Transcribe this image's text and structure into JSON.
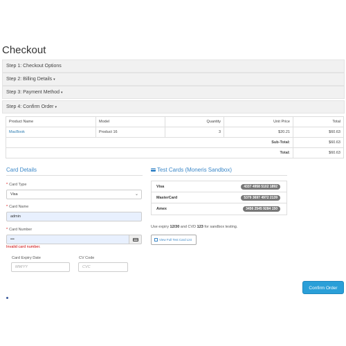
{
  "page": {
    "title": "Checkout"
  },
  "steps": [
    {
      "label": "Step 1: Checkout Options",
      "caret": ""
    },
    {
      "label": "Step 2: Billing Details",
      "caret": "▾"
    },
    {
      "label": "Step 3: Payment Method",
      "caret": "▾"
    },
    {
      "label": "Step 4: Confirm Order",
      "caret": "▾"
    }
  ],
  "cart": {
    "headers": {
      "product": "Product Name",
      "model": "Model",
      "quantity": "Quantity",
      "unit_price": "Unit Price",
      "total": "Total"
    },
    "rows": [
      {
        "product": "MacBook",
        "model": "Product 16",
        "quantity": "3",
        "unit_price": "$20.21",
        "total": "$60.63"
      }
    ],
    "subtotal": {
      "label": "Sub-Total:",
      "value": "$60.63"
    },
    "total": {
      "label": "Total:",
      "value": "$60.63"
    }
  },
  "card_details": {
    "title": "Card Details",
    "card_type": {
      "label": "Card Type",
      "value": "Visa"
    },
    "card_name": {
      "label": "Card Name",
      "value": "admin"
    },
    "card_number": {
      "label": "Card Number",
      "value": "•••"
    },
    "error": "Invalid card number.",
    "expiry": {
      "label": "Card Expiry Date",
      "placeholder": "MM/YY"
    },
    "cvc": {
      "label": "CV Code",
      "placeholder": "CVC"
    }
  },
  "test_cards": {
    "title": "Test Cards (Moneris Sandbox)",
    "icon": "card-icon",
    "cards": [
      {
        "brand": "Visa",
        "number": "4337 4958 5102 1892"
      },
      {
        "brand": "MasterCard",
        "number": "5379 3697 4972 2139"
      },
      {
        "brand": "Amex",
        "number": "3456 2545 9284 150"
      }
    ],
    "hint_prefix": "Use expiry ",
    "hint_expiry": "12/30",
    "hint_middle": " and CVD ",
    "hint_cvd": "123",
    "hint_suffix": " for sandbox testing.",
    "view_button": "View Full Test Card List"
  },
  "actions": {
    "confirm_label": "Confirm Order"
  },
  "colors": {
    "accent": "#2a9fd8",
    "link": "#3a87c8",
    "error": "#cc0000",
    "badge": "#777777"
  }
}
